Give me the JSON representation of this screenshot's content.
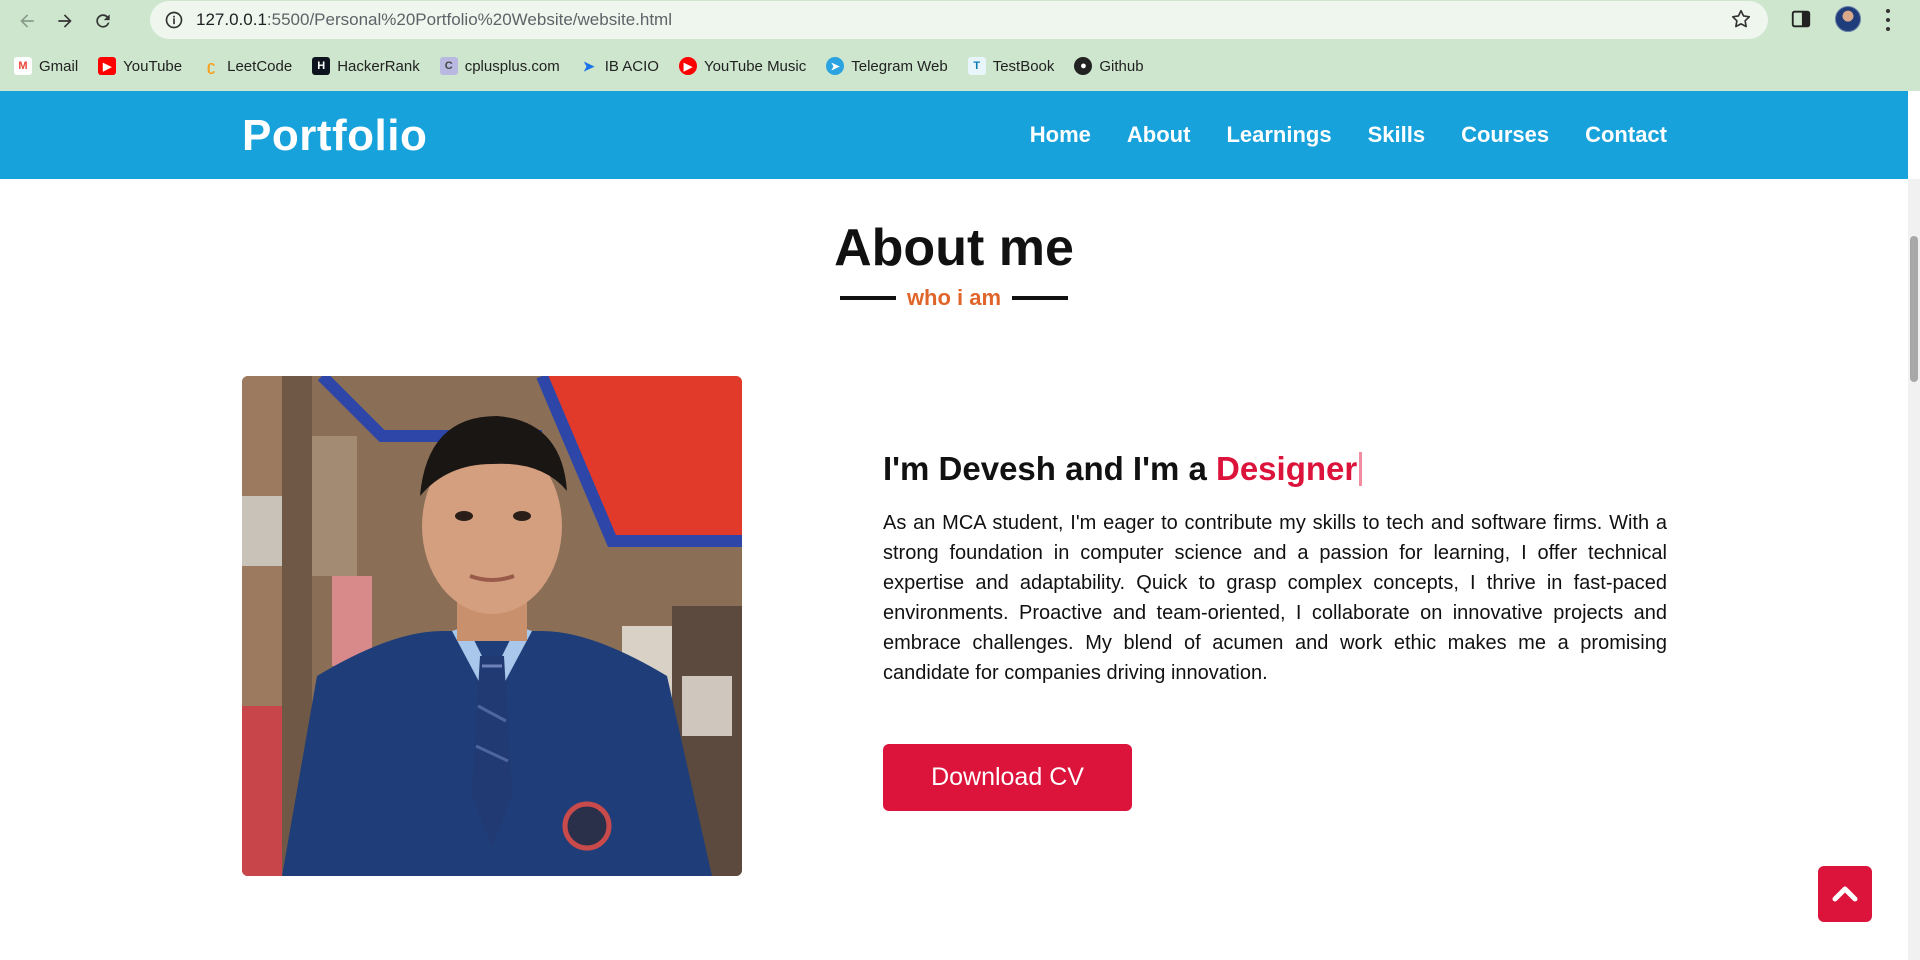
{
  "browser": {
    "url_host": "127.0.0.1",
    "url_rest": ":5500/Personal%20Portfolio%20Website/website.html",
    "bookmarks": [
      {
        "label": "Gmail",
        "icon": "gmail-icon",
        "color": "#ea4335"
      },
      {
        "label": "YouTube",
        "icon": "youtube-icon",
        "color": "#ff0000"
      },
      {
        "label": "LeetCode",
        "icon": "leetcode-icon",
        "color": "#f89f1b"
      },
      {
        "label": "HackerRank",
        "icon": "hackerrank-icon",
        "color": "#1ba94c"
      },
      {
        "label": "cplusplus.com",
        "icon": "cplusplus-icon",
        "color": "#7a7ab8"
      },
      {
        "label": "IB ACIO",
        "icon": "ib-acio-icon",
        "color": "#1a73e8"
      },
      {
        "label": "YouTube Music",
        "icon": "youtube-music-icon",
        "color": "#ff0000"
      },
      {
        "label": "Telegram Web",
        "icon": "telegram-icon",
        "color": "#2aa3e0"
      },
      {
        "label": "TestBook",
        "icon": "testbook-icon",
        "color": "#0ab0e6"
      },
      {
        "label": "Github",
        "icon": "github-icon",
        "color": "#222222"
      }
    ]
  },
  "header": {
    "logo": "Portfolio",
    "nav": [
      "Home",
      "About",
      "Learnings",
      "Skills",
      "Courses",
      "Contact"
    ]
  },
  "about": {
    "title": "About me",
    "subtitle": "who i am",
    "headline_prefix": "I'm Devesh and I'm a ",
    "headline_role": "Designer",
    "bio": "As an MCA student, I'm eager to contribute my skills to tech and software firms. With a strong foundation in computer science and a passion for learning, I offer technical expertise and adaptability. Quick to grasp complex concepts, I thrive in fast-paced environments. Proactive and team-oriented, I collaborate on innovative projects and embrace challenges. My blend of acumen and work ethic makes me a promising candidate for companies driving innovation.",
    "cv_button": "Download CV"
  },
  "colors": {
    "header_bg": "#17a2db",
    "accent": "#dc143c",
    "subtitle": "#e0652a",
    "chrome_bg": "#cde6cd"
  }
}
